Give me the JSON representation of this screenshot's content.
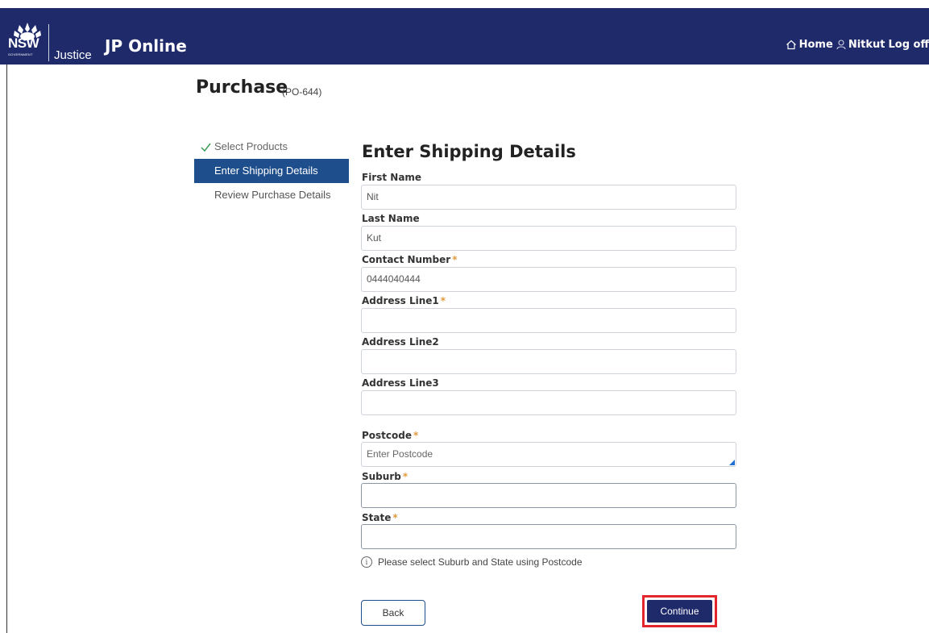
{
  "header": {
    "logo_nsw": "NSW",
    "logo_government": "GOVERNMENT",
    "logo_justice": "Justice",
    "app_title": "JP Online",
    "nav": {
      "home": "Home",
      "user": "Nitkut",
      "logoff": "Log off"
    },
    "background": "#1f2a6b"
  },
  "page": {
    "title": "Purchase",
    "reference": "(PO-644)"
  },
  "steps": [
    {
      "label": "Select Products",
      "state": "completed",
      "icon": "check-icon"
    },
    {
      "label": "Enter Shipping Details",
      "state": "active"
    },
    {
      "label": "Review Purchase Details",
      "state": "pending"
    }
  ],
  "form": {
    "title": "Enter Shipping Details",
    "fields": {
      "first_name": {
        "label": "First Name",
        "value": "Nit",
        "required": false
      },
      "last_name": {
        "label": "Last Name",
        "value": "Kut",
        "required": false
      },
      "contact_number": {
        "label": "Contact Number",
        "value": "0444040444",
        "required": true
      },
      "address_line1": {
        "label": "Address Line1",
        "value": "",
        "required": true
      },
      "address_line2": {
        "label": "Address Line2",
        "value": "",
        "required": false
      },
      "address_line3": {
        "label": "Address Line3",
        "value": "",
        "required": false
      },
      "postcode": {
        "label": "Postcode",
        "value": "",
        "placeholder": "Enter Postcode",
        "required": true
      },
      "suburb": {
        "label": "Suburb",
        "value": "",
        "required": true
      },
      "state": {
        "label": "State",
        "value": "",
        "required": true
      }
    },
    "required_marker": "*",
    "info_text": "Please select Suburb and State using Postcode",
    "back_label": "Back",
    "continue_label": "Continue"
  },
  "colors": {
    "primary": "#1f2a6b",
    "active_step": "#1f4e8c",
    "required": "#e29a3e",
    "highlight": "#e3262d"
  }
}
